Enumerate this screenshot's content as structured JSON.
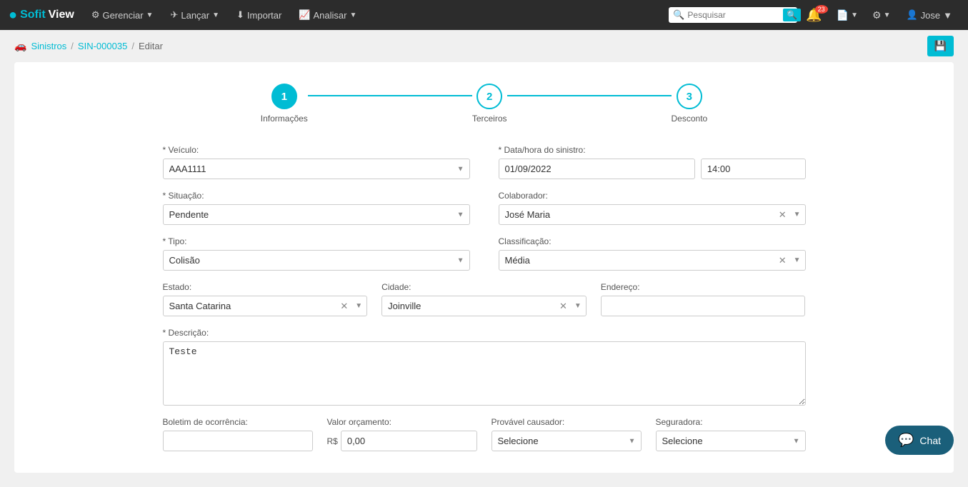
{
  "brand": {
    "sofit": "Sofit",
    "view": "View"
  },
  "nav": {
    "gerenciar": "Gerenciar",
    "lancar": "Lançar",
    "importar": "Importar",
    "analisar": "Analisar"
  },
  "search": {
    "placeholder": "Pesquisar"
  },
  "notifications": {
    "count": "23"
  },
  "user": {
    "name": "Jose"
  },
  "breadcrumb": {
    "sinistros": "Sinistros",
    "record": "SIN-000035",
    "current": "Editar"
  },
  "stepper": {
    "step1": {
      "number": "1",
      "label": "Informações"
    },
    "step2": {
      "number": "2",
      "label": "Terceiros"
    },
    "step3": {
      "number": "3",
      "label": "Desconto"
    }
  },
  "form": {
    "veiculo_label": "* Veículo:",
    "veiculo_value": "AAA1111",
    "data_hora_label": "* Data/hora do sinistro:",
    "data_value": "01/09/2022",
    "hora_value": "14:00",
    "situacao_label": "* Situação:",
    "situacao_value": "Pendente",
    "colaborador_label": "Colaborador:",
    "colaborador_value": "José Maria",
    "tipo_label": "* Tipo:",
    "tipo_value": "Colisão",
    "classificacao_label": "Classificação:",
    "classificacao_value": "Média",
    "estado_label": "Estado:",
    "estado_value": "Santa Catarina",
    "cidade_label": "Cidade:",
    "cidade_value": "Joinville",
    "endereco_label": "Endereço:",
    "endereco_value": "",
    "descricao_label": "* Descrição:",
    "descricao_value": "Teste",
    "boletim_label": "Boletim de ocorrência:",
    "boletim_value": "",
    "valor_orcamento_label": "Valor orçamento:",
    "valor_orcamento_prefix": "R$",
    "valor_orcamento_value": "0,00",
    "provavel_causador_label": "Provável causador:",
    "provavel_causador_placeholder": "Selecione",
    "seguradora_label": "Seguradora:",
    "seguradora_placeholder": "Selecione"
  },
  "buttons": {
    "save_icon": "💾",
    "chat_icon": "💬",
    "chat_label": "Chat"
  }
}
